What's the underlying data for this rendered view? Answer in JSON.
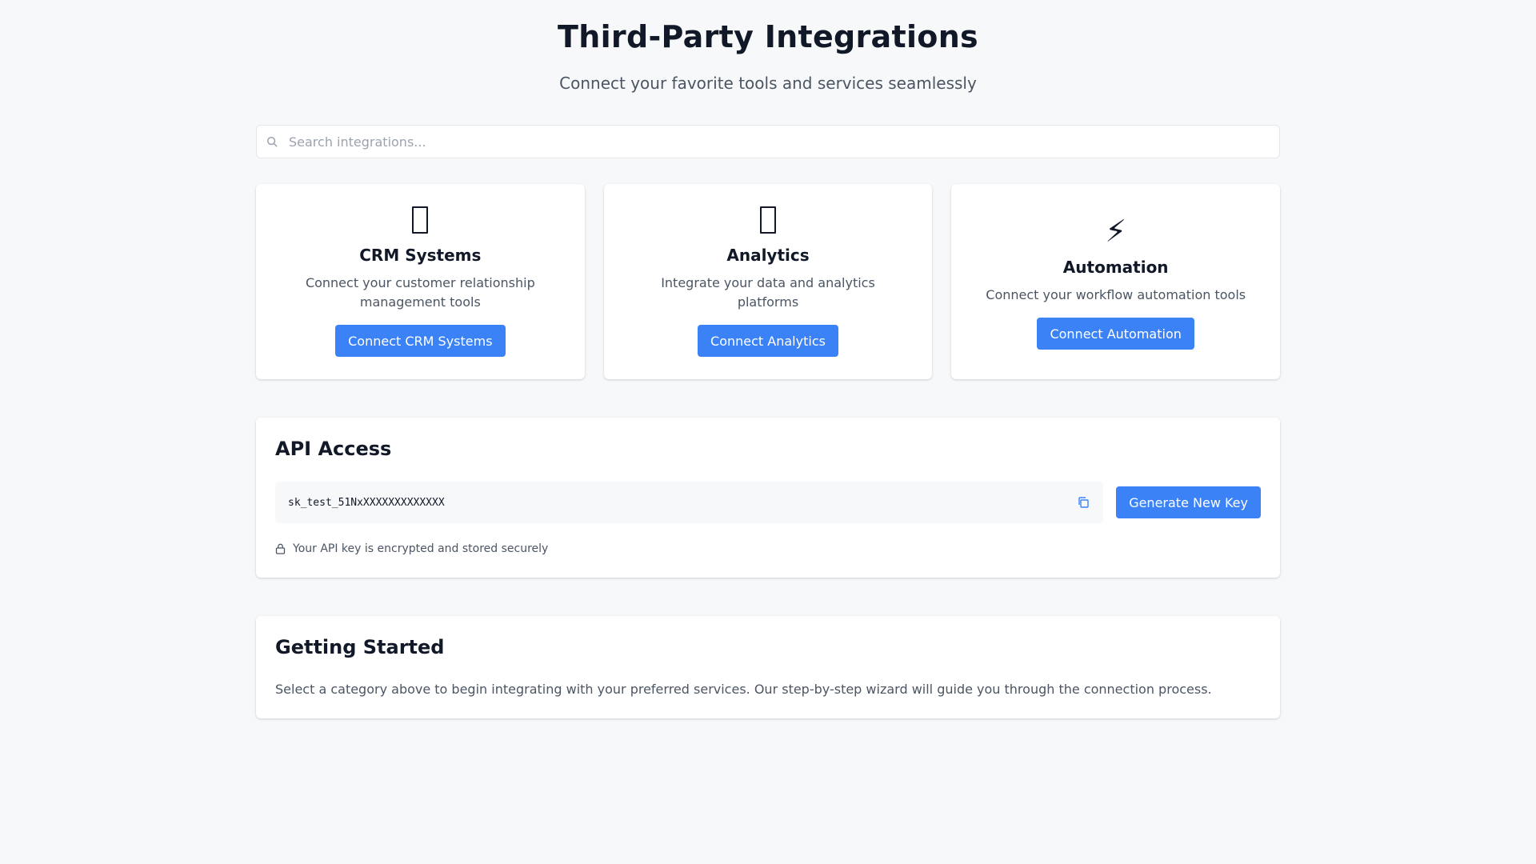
{
  "header": {
    "title": "Third-Party Integrations",
    "subtitle": "Connect your favorite tools and services seamlessly"
  },
  "search": {
    "placeholder": "Search integrations...",
    "value": "",
    "icon": "search-icon"
  },
  "categories": [
    {
      "icon": "phone-icon",
      "glyph": "",
      "title": "CRM Systems",
      "description": "Connect your customer relationship management tools",
      "button_label": "Connect CRM Systems"
    },
    {
      "icon": "chart-icon",
      "glyph": "",
      "title": "Analytics",
      "description": "Integrate your data and analytics platforms",
      "button_label": "Connect Analytics"
    },
    {
      "icon": "lightning-icon",
      "glyph": "⚡",
      "title": "Automation",
      "description": "Connect your workflow automation tools",
      "button_label": "Connect Automation"
    }
  ],
  "api": {
    "title": "API Access",
    "key": "sk_test_51NxXXXXXXXXXXXXX",
    "generate_label": "Generate New Key",
    "note": "Your API key is encrypted and stored securely"
  },
  "getting_started": {
    "title": "Getting Started",
    "text": "Select a category above to begin integrating with your preferred services. Our step-by-step wizard will guide you through the connection process."
  },
  "colors": {
    "accent": "#3b82f6",
    "background": "#f7f8fa",
    "text": "#111827",
    "muted": "#4b5563"
  }
}
